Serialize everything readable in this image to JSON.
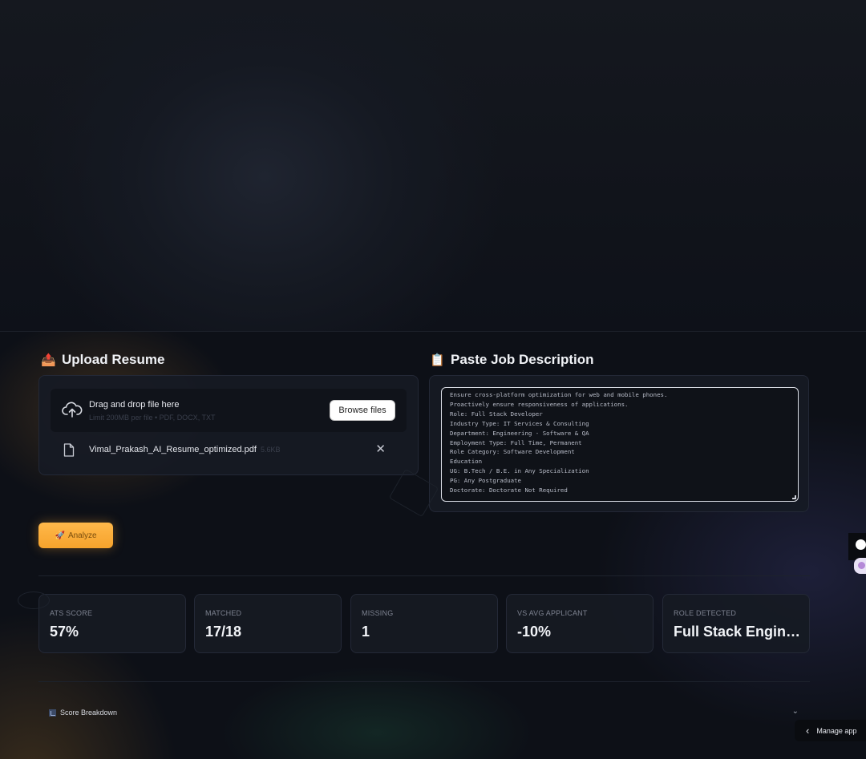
{
  "upload": {
    "emoji": "📤",
    "title": "Upload Resume",
    "dropzone_title": "Drag and drop file here",
    "dropzone_sub": "Limit 200MB per file • PDF, DOCX, TXT",
    "browse_label": "Browse files",
    "file_name": "Vimal_Prakash_AI_Resume_optimized.pdf",
    "file_size": "5.6KB",
    "remove_glyph": "✕"
  },
  "job": {
    "emoji": "📋",
    "title": "Paste Job Description",
    "lines": [
      "Ensure cross-platform optimization for web and mobile phones.",
      "Proactively ensure responsiveness of applications.",
      "Role: Full Stack Developer",
      "Industry Type: IT Services & Consulting",
      "Department: Engineering - Software & QA",
      "Employment Type: Full Time, Permanent",
      "Role Category: Software Development",
      "Education",
      "UG: B.Tech / B.E. in Any Specialization",
      "PG: Any Postgraduate",
      "Doctorate: Doctorate Not Required"
    ]
  },
  "analyze": {
    "emoji": "🚀",
    "label": "Analyze"
  },
  "metrics": [
    {
      "label": "ATS Score",
      "value": "57%"
    },
    {
      "label": "Matched",
      "value": "17/18"
    },
    {
      "label": "Missing",
      "value": "1"
    },
    {
      "label": "vs Avg Applicant",
      "value": "-10%"
    },
    {
      "label": "Role Detected",
      "value": "Full Stack Engineer"
    }
  ],
  "breakdown": {
    "label": "Score Breakdown",
    "chevron": "⌄"
  },
  "manage": {
    "chevron": "‹",
    "label": "Manage app"
  },
  "colors": {
    "accent": "#f6a32c",
    "background": "#0d1017",
    "card": "#161a24"
  }
}
